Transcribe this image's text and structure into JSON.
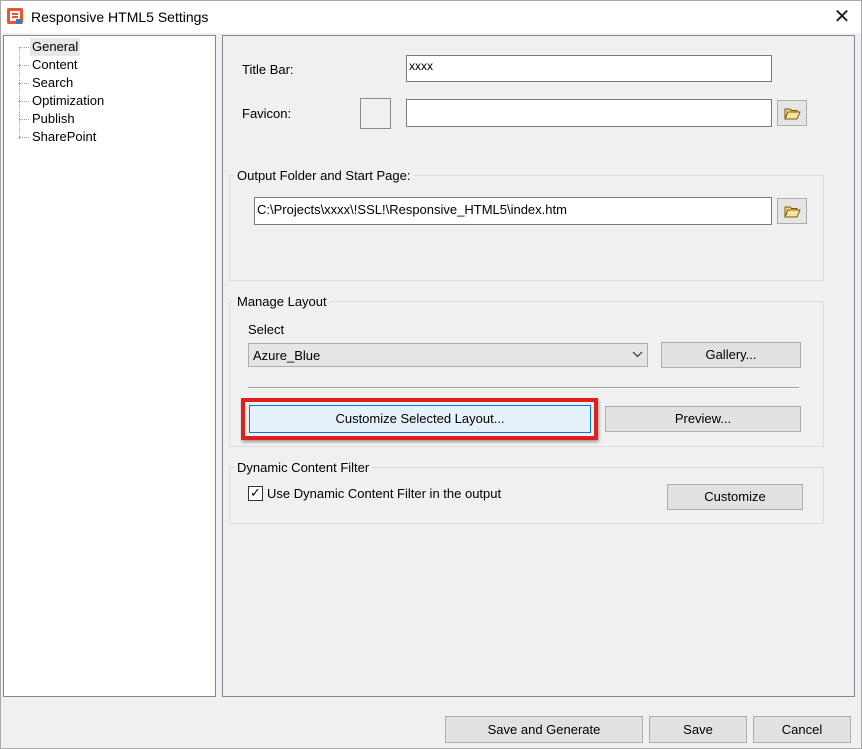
{
  "window": {
    "title": "Responsive HTML5 Settings",
    "close_label": "✕"
  },
  "tree": {
    "items": [
      {
        "label": "General",
        "selected": true
      },
      {
        "label": "Content"
      },
      {
        "label": "Search"
      },
      {
        "label": "Optimization"
      },
      {
        "label": "Publish"
      },
      {
        "label": "SharePoint"
      }
    ]
  },
  "general": {
    "title_bar_label": "Title Bar:",
    "title_bar_value": "xxxx",
    "favicon_label": "Favicon:",
    "favicon_value": "",
    "favicon_browse_icon": "folder-open-icon"
  },
  "output": {
    "group_label": "Output Folder and Start Page:",
    "path_value": "C:\\Projects\\xxxx\\!SSL!\\Responsive_HTML5\\index.htm",
    "browse_icon": "folder-open-icon"
  },
  "layout": {
    "group_label": "Manage Layout",
    "select_label": "Select",
    "selected_value": "Azure_Blue",
    "gallery_label": "Gallery...",
    "customize_label": "Customize Selected Layout...",
    "preview_label": "Preview...",
    "highlight_color": "#e01e1e"
  },
  "dcf": {
    "group_label": "Dynamic Content Filter",
    "checkbox_label": "Use Dynamic Content Filter in the output",
    "checked": true,
    "check_mark": "✓",
    "customize_label": "Customize"
  },
  "footer": {
    "save_generate_label": "Save and Generate",
    "save_label": "Save",
    "cancel_label": "Cancel"
  }
}
